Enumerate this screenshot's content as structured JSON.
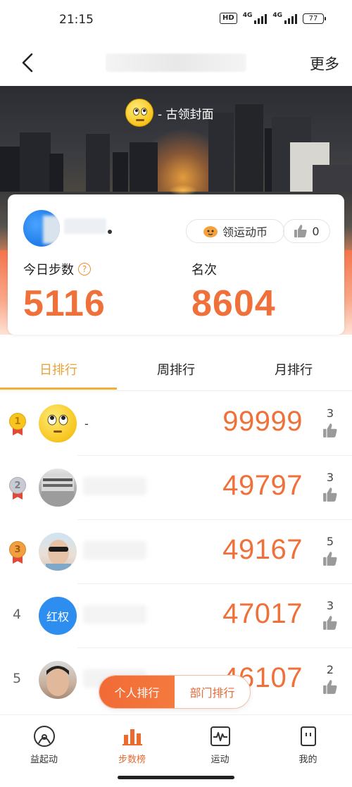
{
  "status_bar": {
    "time": "21:15",
    "hd": "HD",
    "network_1": "4G",
    "network_2": "4G",
    "battery": "77"
  },
  "nav": {
    "more_label": "更多"
  },
  "hero": {
    "brand_text": "- 古领封面"
  },
  "user_card": {
    "coin_label": "领运动币",
    "like_count": "0",
    "today_steps_label": "今日步数",
    "help_glyph": "?",
    "today_steps": "5116",
    "rank_label": "名次",
    "rank_value": "8604"
  },
  "tabs": [
    {
      "label": "日排行",
      "active": true
    },
    {
      "label": "周排行",
      "active": false
    },
    {
      "label": "月排行",
      "active": false
    }
  ],
  "ranking": [
    {
      "rank": "1",
      "name": "-",
      "steps": "99999",
      "likes": "3",
      "medal": "gold"
    },
    {
      "rank": "2",
      "name": "",
      "steps": "49797",
      "likes": "3",
      "medal": "silver"
    },
    {
      "rank": "3",
      "name": "",
      "steps": "49167",
      "likes": "5",
      "medal": "bronze"
    },
    {
      "rank": "4",
      "name": "",
      "steps": "47017",
      "likes": "3",
      "avatar_text": "红权"
    },
    {
      "rank": "5",
      "name": "",
      "steps": "46107",
      "likes": "2"
    }
  ],
  "segment_toggle": {
    "personal_label": "个人排行",
    "department_label": "部门排行"
  },
  "bottom_nav": [
    {
      "label": "益起动",
      "icon": "charity-icon",
      "active": false
    },
    {
      "label": "步数榜",
      "icon": "bar-chart-icon",
      "active": true
    },
    {
      "label": "运动",
      "icon": "activity-icon",
      "active": false
    },
    {
      "label": "我的",
      "icon": "profile-icon",
      "active": false
    }
  ],
  "colors": {
    "accent_orange": "#f0703a",
    "tab_active": "#e8a23a",
    "gold": "#f7c51e",
    "silver": "#c8ccd2",
    "bronze": "#f0a040"
  }
}
